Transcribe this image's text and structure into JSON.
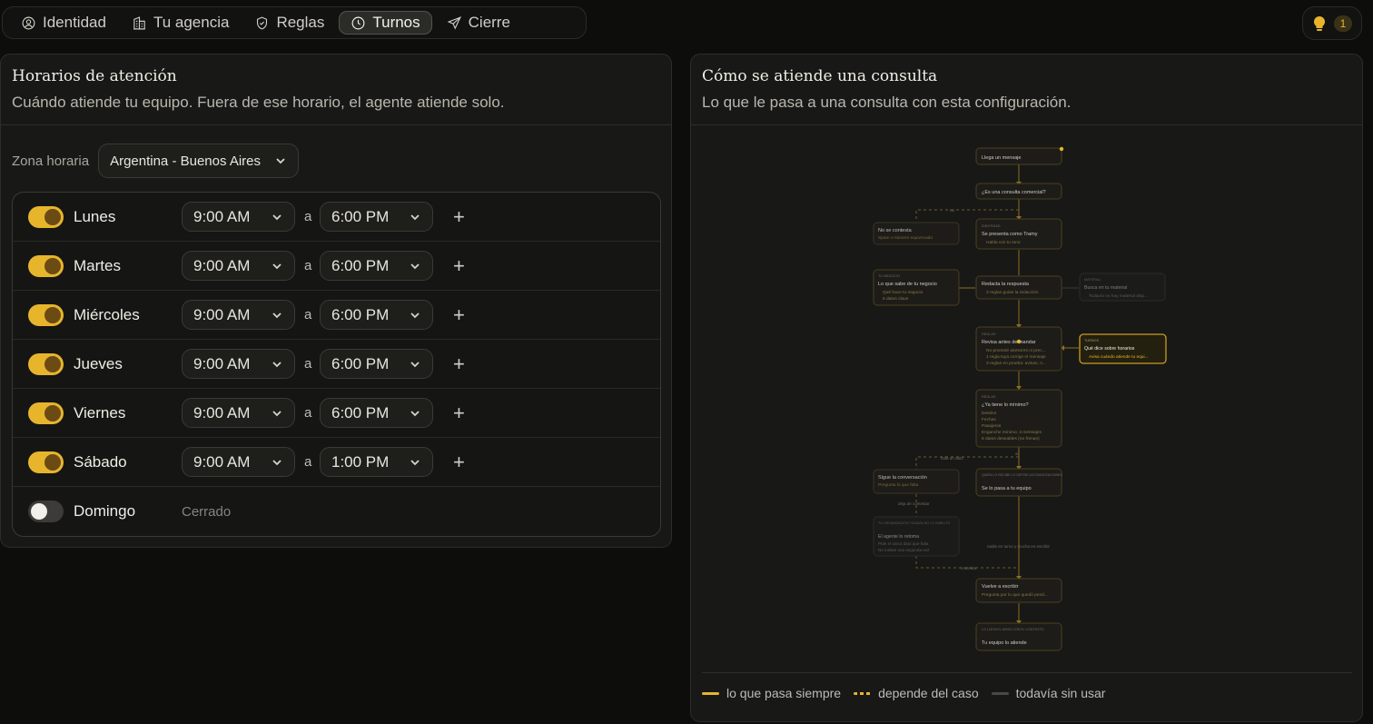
{
  "nav": {
    "tabs": [
      {
        "label": "Identidad",
        "icon": "user-circle-icon"
      },
      {
        "label": "Tu agencia",
        "icon": "building-icon"
      },
      {
        "label": "Reglas",
        "icon": "shield-icon"
      },
      {
        "label": "Turnos",
        "icon": "clock-icon",
        "active": true
      },
      {
        "label": "Cierre",
        "icon": "send-icon"
      }
    ],
    "tips_count": "1"
  },
  "hours": {
    "title": "Horarios de atención",
    "subtitle": "Cuándo atiende tu equipo. Fuera de ese horario, el agente atiende solo.",
    "timezone_label": "Zona horaria",
    "timezone_value": "Argentina - Buenos Aires",
    "separator": "a",
    "closed_label": "Cerrado",
    "days": [
      {
        "name": "Lunes",
        "enabled": true,
        "from": "9:00 AM",
        "to": "6:00 PM"
      },
      {
        "name": "Martes",
        "enabled": true,
        "from": "9:00 AM",
        "to": "6:00 PM"
      },
      {
        "name": "Miércoles",
        "enabled": true,
        "from": "9:00 AM",
        "to": "6:00 PM"
      },
      {
        "name": "Jueves",
        "enabled": true,
        "from": "9:00 AM",
        "to": "6:00 PM"
      },
      {
        "name": "Viernes",
        "enabled": true,
        "from": "9:00 AM",
        "to": "6:00 PM"
      },
      {
        "name": "Sábado",
        "enabled": true,
        "from": "9:00 AM",
        "to": "1:00 PM"
      },
      {
        "name": "Domingo",
        "enabled": false
      }
    ]
  },
  "flow": {
    "title": "Cómo se atiende una consulta",
    "subtitle": "Lo que le pasa a una consulta con esta configuración.",
    "nodes": {
      "n1": {
        "title": "Llega un mensaje"
      },
      "n2": {
        "title": "¿Es una consulta comercial?"
      },
      "n3": {
        "title": "No se contesta",
        "line": "Spam o número equivocado"
      },
      "n4": {
        "tag": "IDENTIDAD",
        "title": "Se presenta como Tramy",
        "line": "Habla con tu tono"
      },
      "n5": {
        "tag": "TU NEGOCIO",
        "title": "Lo que sabe de tu negocio",
        "line": "Qué hace tu negocio",
        "line2": "6 datos clave"
      },
      "n6": {
        "title": "Redacta la respuesta",
        "line": "3 reglas guían la redacción"
      },
      "n7": {
        "tag": "MATERIAL",
        "title": "Busca en tu material",
        "line": "Todavía no hay material disp..."
      },
      "n8": {
        "tag": "REGLAS",
        "title": "Revisa antes de mandar",
        "line": "No prometé asesores ni prec...",
        "line2": "1 regla tuya corrige el mensaje",
        "line3": "3 reglas en prueba: avisan, n..."
      },
      "n9": {
        "tag": "TURNOS",
        "title": "Qué dice sobre horarios",
        "line": "Avisa cuándo atiende tu equi..."
      },
      "n10": {
        "tag": "REGLAS",
        "title": "¿Ya tiene lo mínimo?",
        "lines": [
          "Destino",
          "Fechas",
          "Pasajeros",
          "Enganche mínimo: 3 mensajes",
          "6 datos deseables (no frenan)"
        ]
      },
      "n11": {
        "title": "Sigue la conversación",
        "line": "Pregunta lo que falta"
      },
      "n12": {
        "tag": "QUIÉN LO RECIBE LO DEFINE AUTOMATIZACIONES",
        "title": "Se lo pasa a tu equipo"
      },
      "n13": {
        "tag": "TU ORGANIZACIÓN TODAVÍA NO LO HABILITÓ",
        "title": "El agente lo retoma",
        "line": "Pide el único dato que falta",
        "line2": "No insiste una segunda vez"
      },
      "n14": {
        "title": "Vuelve a escribir",
        "line": "Pregunta por lo que quedó pend..."
      },
      "n15": {
        "tag": "LO LLEVA EL AVISO CON EL CONTEXTO",
        "title": "Tu equipo lo atiende"
      }
    },
    "edges": {
      "no": "no",
      "si": "sí",
      "falta": "falta un dato",
      "deja": "deja de contestar",
      "nadie": "nadie en turno y mucha en escribir",
      "contesta": "contesta"
    }
  },
  "legend": {
    "always": "lo que pasa siempre",
    "depends": "depende del caso",
    "unused": "todavía sin usar"
  },
  "colors": {
    "accent": "#e7b52c",
    "background": "#0d0d0c",
    "panel": "#181816"
  }
}
